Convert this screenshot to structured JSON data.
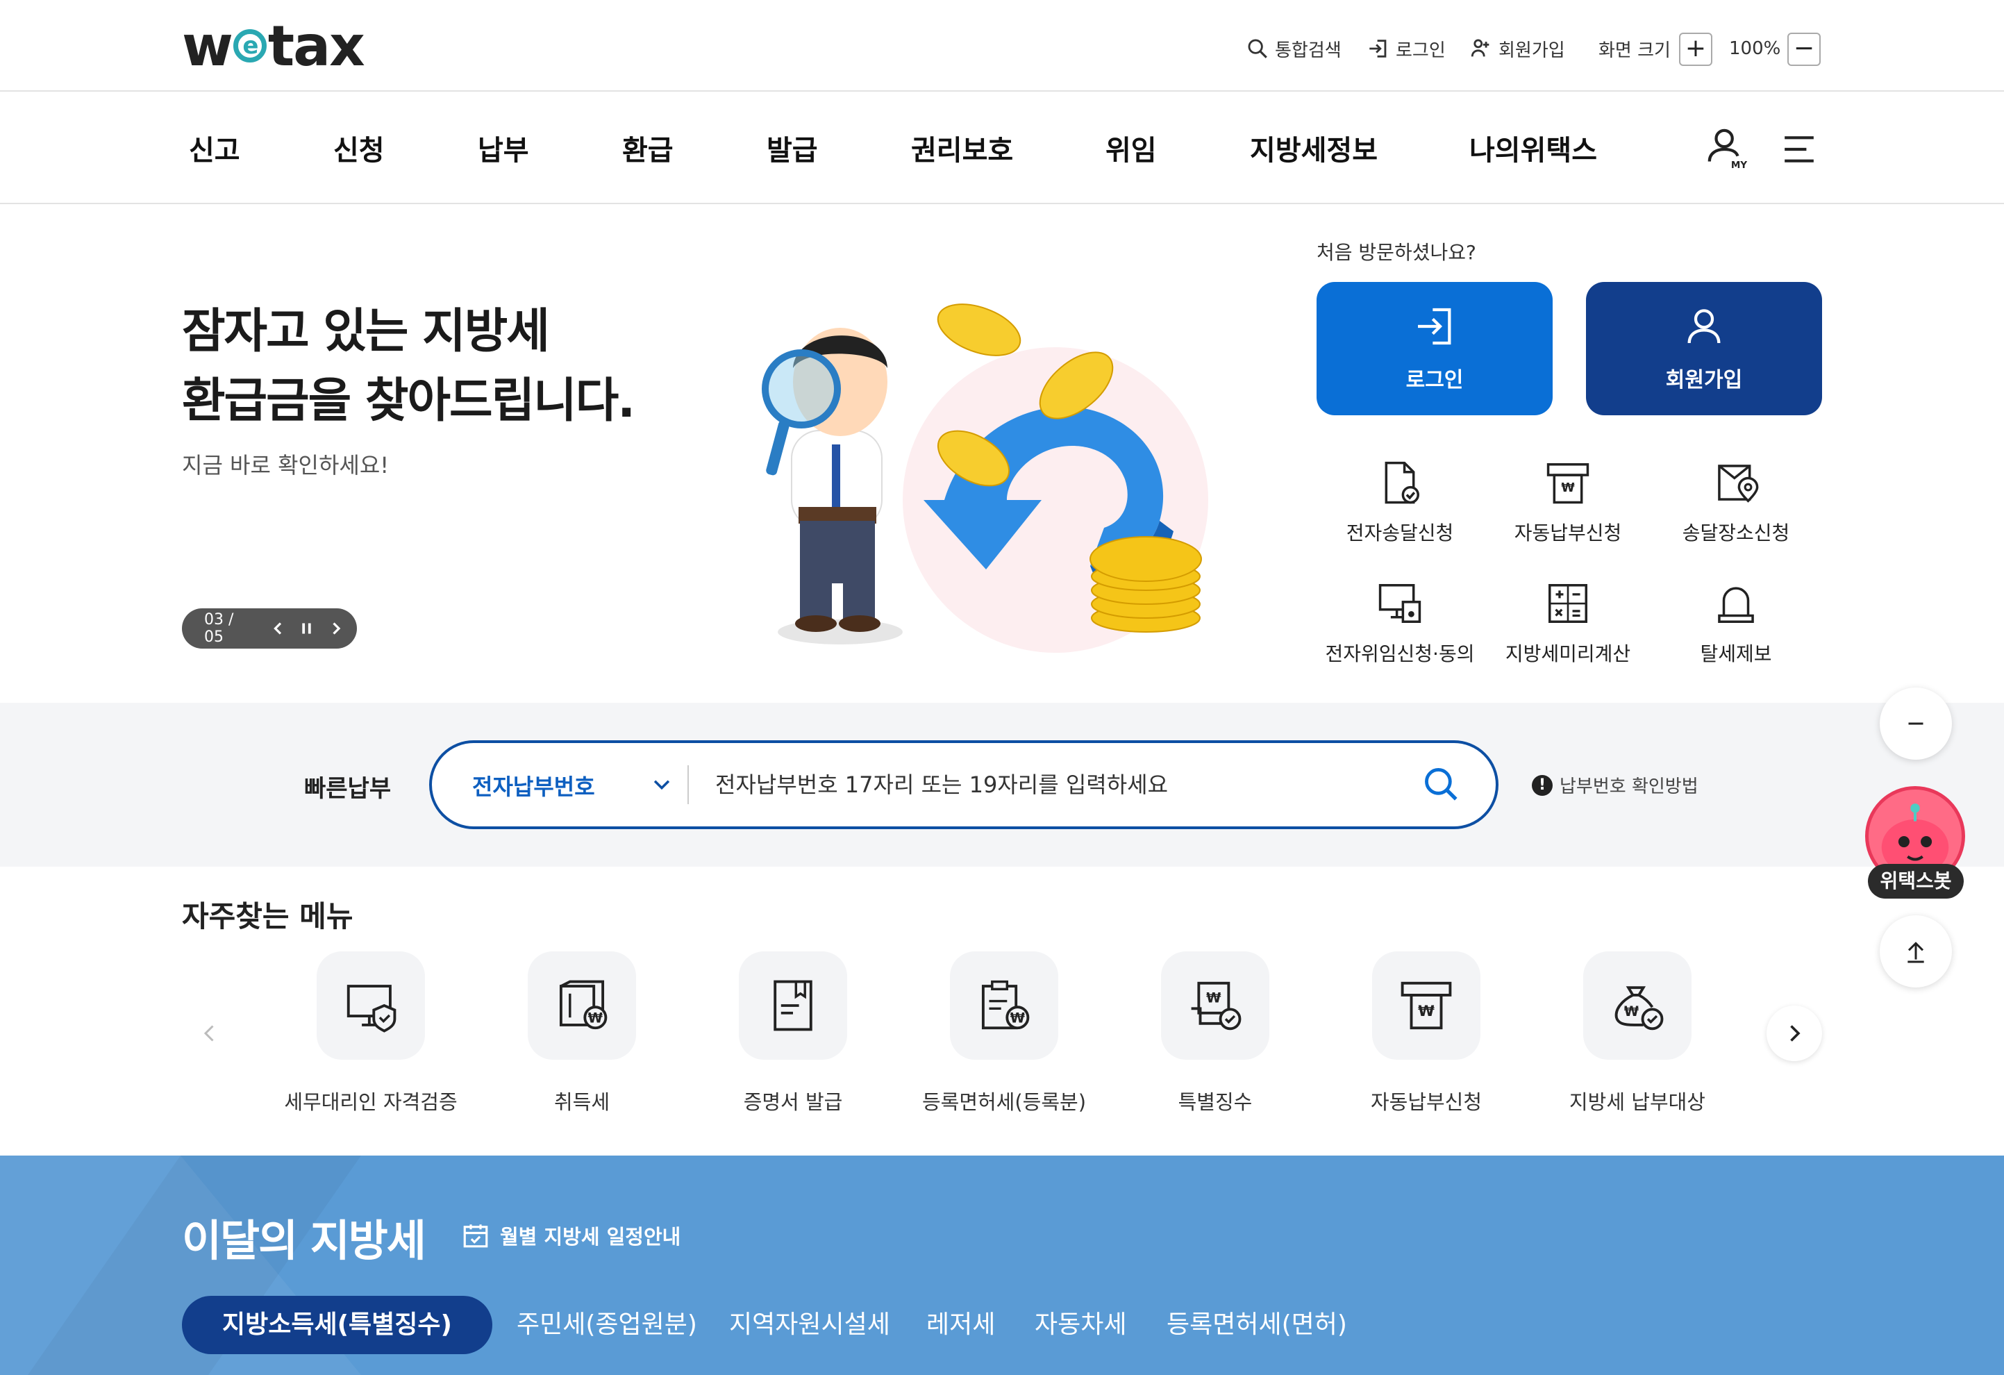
{
  "header": {
    "logo_pre": "w",
    "logo_e": "e",
    "logo_post": "tax",
    "util": {
      "search": "통합검색",
      "login": "로그인",
      "signup": "회원가입",
      "screen_size": "화면 크기",
      "zoom_value": "100%",
      "zoom_in": "+",
      "zoom_out": "−"
    }
  },
  "gnb": [
    "신고",
    "신청",
    "납부",
    "환급",
    "발급",
    "권리보호",
    "위임",
    "지방세정보",
    "나의위택스"
  ],
  "hero": {
    "title": "잠자고 있는 지방세\n환급금을 찾아드립니다.",
    "subtitle": "지금 바로 확인하세요!",
    "slide_counter": "03 / 05"
  },
  "visitor": {
    "question": "처음 방문하셨나요?",
    "login_label": "로그인",
    "signup_label": "회원가입"
  },
  "quick_links": [
    "전자송달신청",
    "자동납부신청",
    "송달장소신청",
    "전자위임신청·동의",
    "지방세미리계산",
    "탈세제보"
  ],
  "fast_pay": {
    "label": "빠른납부",
    "select_value": "전자납부번호",
    "placeholder": "전자납부번호 17자리 또는 19자리를 입력하세요",
    "help_icon": "!",
    "help": "납부번호 확인방법"
  },
  "side": {
    "bot_label": "위택스봇"
  },
  "frequent": {
    "title": "자주찾는 메뉴",
    "items": [
      "세무대리인 자격검증",
      "취득세",
      "증명서 발급",
      "등록면허세(등록분)",
      "특별징수",
      "자동납부신청",
      "지방세 납부대상"
    ]
  },
  "month_tax": {
    "title": "이달의 지방세",
    "schedule_link": "월별 지방세 일정안내",
    "tabs": [
      "지방소득세(특별징수)",
      "주민세(종업원분)",
      "지역자원시설세",
      "레저세",
      "자동차세",
      "등록면허세(면허)"
    ]
  },
  "colors": {
    "primary_blue": "#0a6fd6",
    "navy": "#123e8c",
    "accent_teal": "#2aa8b2",
    "month_bg": "#5a9bd5"
  },
  "icons": [
    "search-icon",
    "login-icon",
    "signup-icon",
    "my-page-icon",
    "hamburger-icon",
    "prev-icon",
    "pause-icon",
    "next-icon",
    "document-check-icon",
    "auto-pay-icon",
    "location-doc-icon",
    "monitor-doc-icon",
    "calculator-icon",
    "bell-icon",
    "chevron-down-icon",
    "minus-icon",
    "arrow-up-icon",
    "calendar-icon"
  ]
}
